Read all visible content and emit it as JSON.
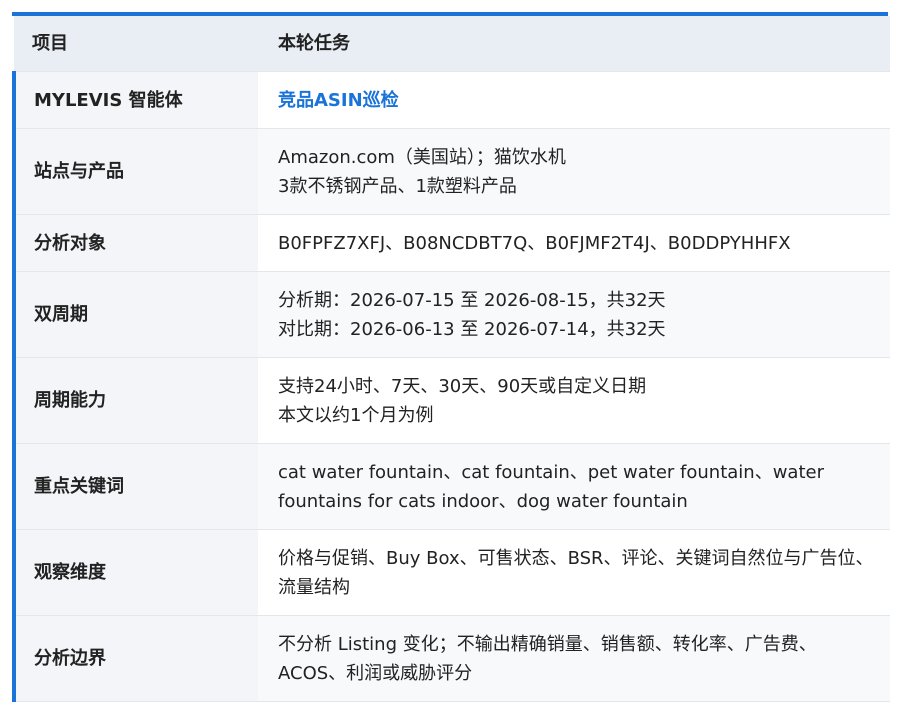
{
  "header": {
    "col_item": "项目",
    "col_task": "本轮任务"
  },
  "rows": [
    {
      "label": "MYLEVIS 智能体",
      "lines": [
        "竞品ASIN巡检"
      ]
    },
    {
      "label": "站点与产品",
      "lines": [
        "Amazon.com（美国站）；猫饮水机",
        "3款不锈钢产品、1款塑料产品"
      ]
    },
    {
      "label": "分析对象",
      "lines": [
        "B0FPFZ7XFJ、B08NCDBT7Q、B0FJMF2T4J、B0DDPYHHFX"
      ]
    },
    {
      "label": "双周期",
      "lines": [
        "分析期：2026-07-15 至 2026-08-15，共32天",
        "对比期：2026-06-13 至 2026-07-14，共32天"
      ]
    },
    {
      "label": "周期能力",
      "lines": [
        "支持24小时、7天、30天、90天或自定义日期",
        "本文以约1个月为例"
      ]
    },
    {
      "label": "重点关键词",
      "text": "cat water fountain、cat fountain、pet water fountain、water fountains for cats indoor、dog water fountain"
    },
    {
      "label": "观察维度",
      "text": "价格与促销、Buy Box、可售状态、BSR、评论、关键词自然位与广告位、流量结构"
    },
    {
      "label": "分析边界",
      "text": "不分析 Listing 变化；不输出精确销量、销售额、转化率、广告费、ACOS、利润或威胁评分"
    }
  ],
  "colors": {
    "accent": "#1a73d9",
    "header_bg": "#e9eef5",
    "label_bg": "#f3f5f8"
  }
}
